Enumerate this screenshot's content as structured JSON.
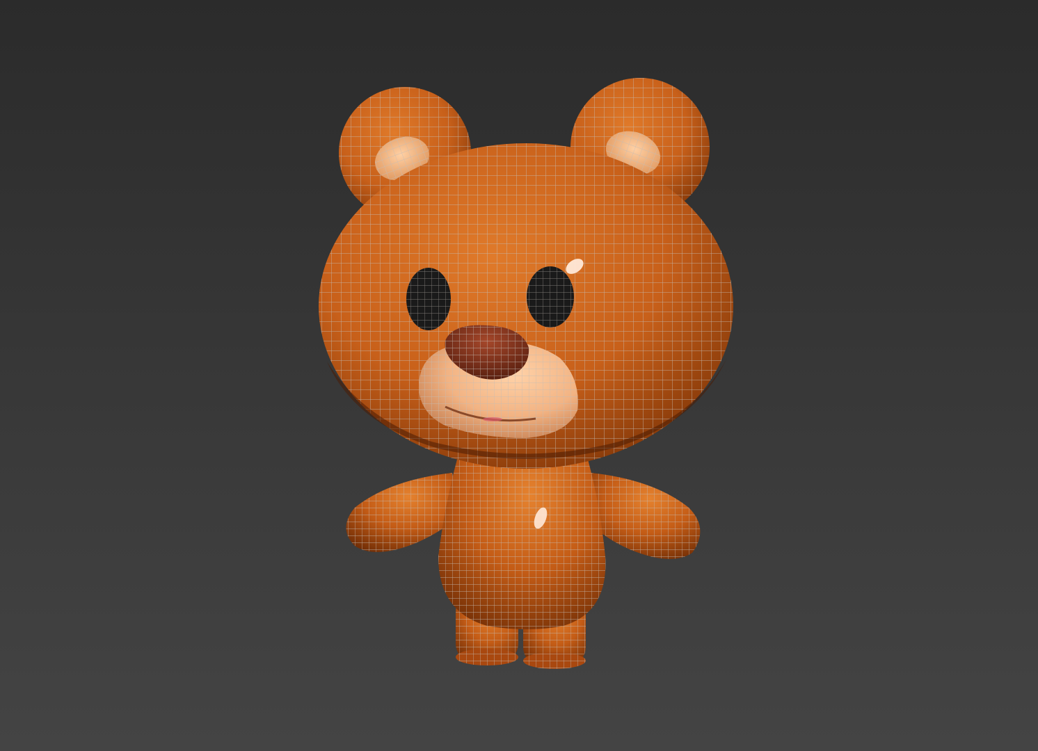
{
  "viewport": {
    "background_top": "#2b2b2b",
    "background_bottom": "#444444",
    "shading_mode": "smooth-highlights-edged-faces"
  },
  "model": {
    "subject": "teddy-bear",
    "colors": {
      "fur": "#c8601a",
      "fur_dark": "#8a3a08",
      "fur_light": "#e07a2a",
      "muzzle": "#f2b383",
      "inner_ear": "#f0b07a",
      "nose": "#7a2e12",
      "eye": "#1a1a1a",
      "wireframe": "#b8b0a8",
      "specular": "#ffe9d8"
    }
  }
}
